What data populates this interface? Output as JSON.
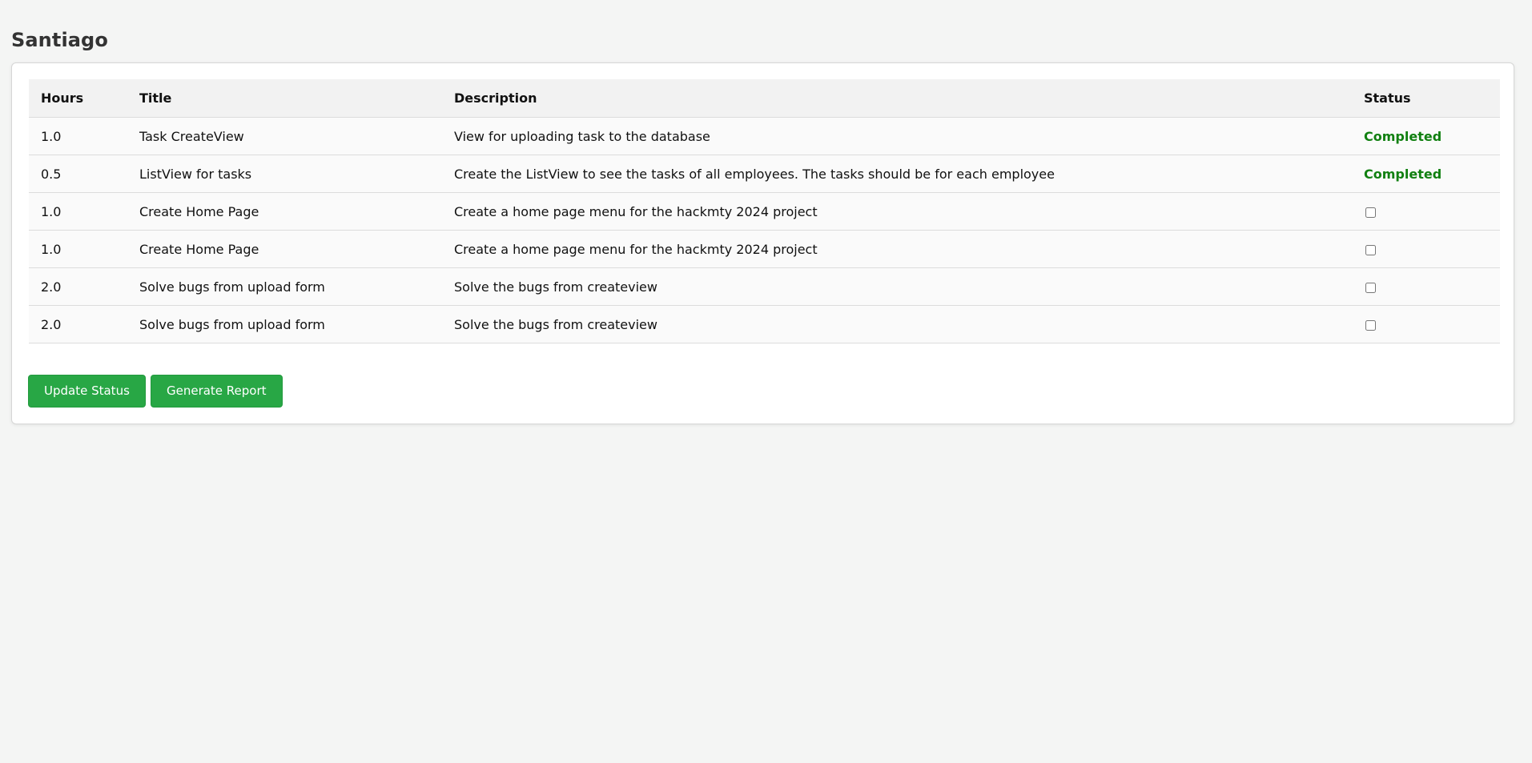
{
  "page": {
    "title": "Santiago"
  },
  "table": {
    "headers": {
      "hours": "Hours",
      "title": "Title",
      "description": "Description",
      "status": "Status"
    },
    "rows": [
      {
        "hours": "1.0",
        "title": "Task CreateView",
        "description": "View for uploading task to the database",
        "status": "Completed",
        "completed": true
      },
      {
        "hours": "0.5",
        "title": "ListView for tasks",
        "description": "Create the ListView to see the tasks of all employees. The tasks should be for each employee",
        "status": "Completed",
        "completed": true
      },
      {
        "hours": "1.0",
        "title": "Create Home Page",
        "description": "Create a home page menu for the hackmty 2024 project",
        "status": "",
        "completed": false
      },
      {
        "hours": "1.0",
        "title": "Create Home Page",
        "description": "Create a home page menu for the hackmty 2024 project",
        "status": "",
        "completed": false
      },
      {
        "hours": "2.0",
        "title": "Solve bugs from upload form",
        "description": "Solve the bugs from createview",
        "status": "",
        "completed": false
      },
      {
        "hours": "2.0",
        "title": "Solve bugs from upload form",
        "description": "Solve the bugs from createview",
        "status": "",
        "completed": false
      }
    ]
  },
  "actions": {
    "update_status_label": "Update Status",
    "generate_report_label": "Generate Report"
  },
  "colors": {
    "accent_button": "#28a745",
    "completed_text": "#118011",
    "page_background": "#f4f5f4"
  }
}
